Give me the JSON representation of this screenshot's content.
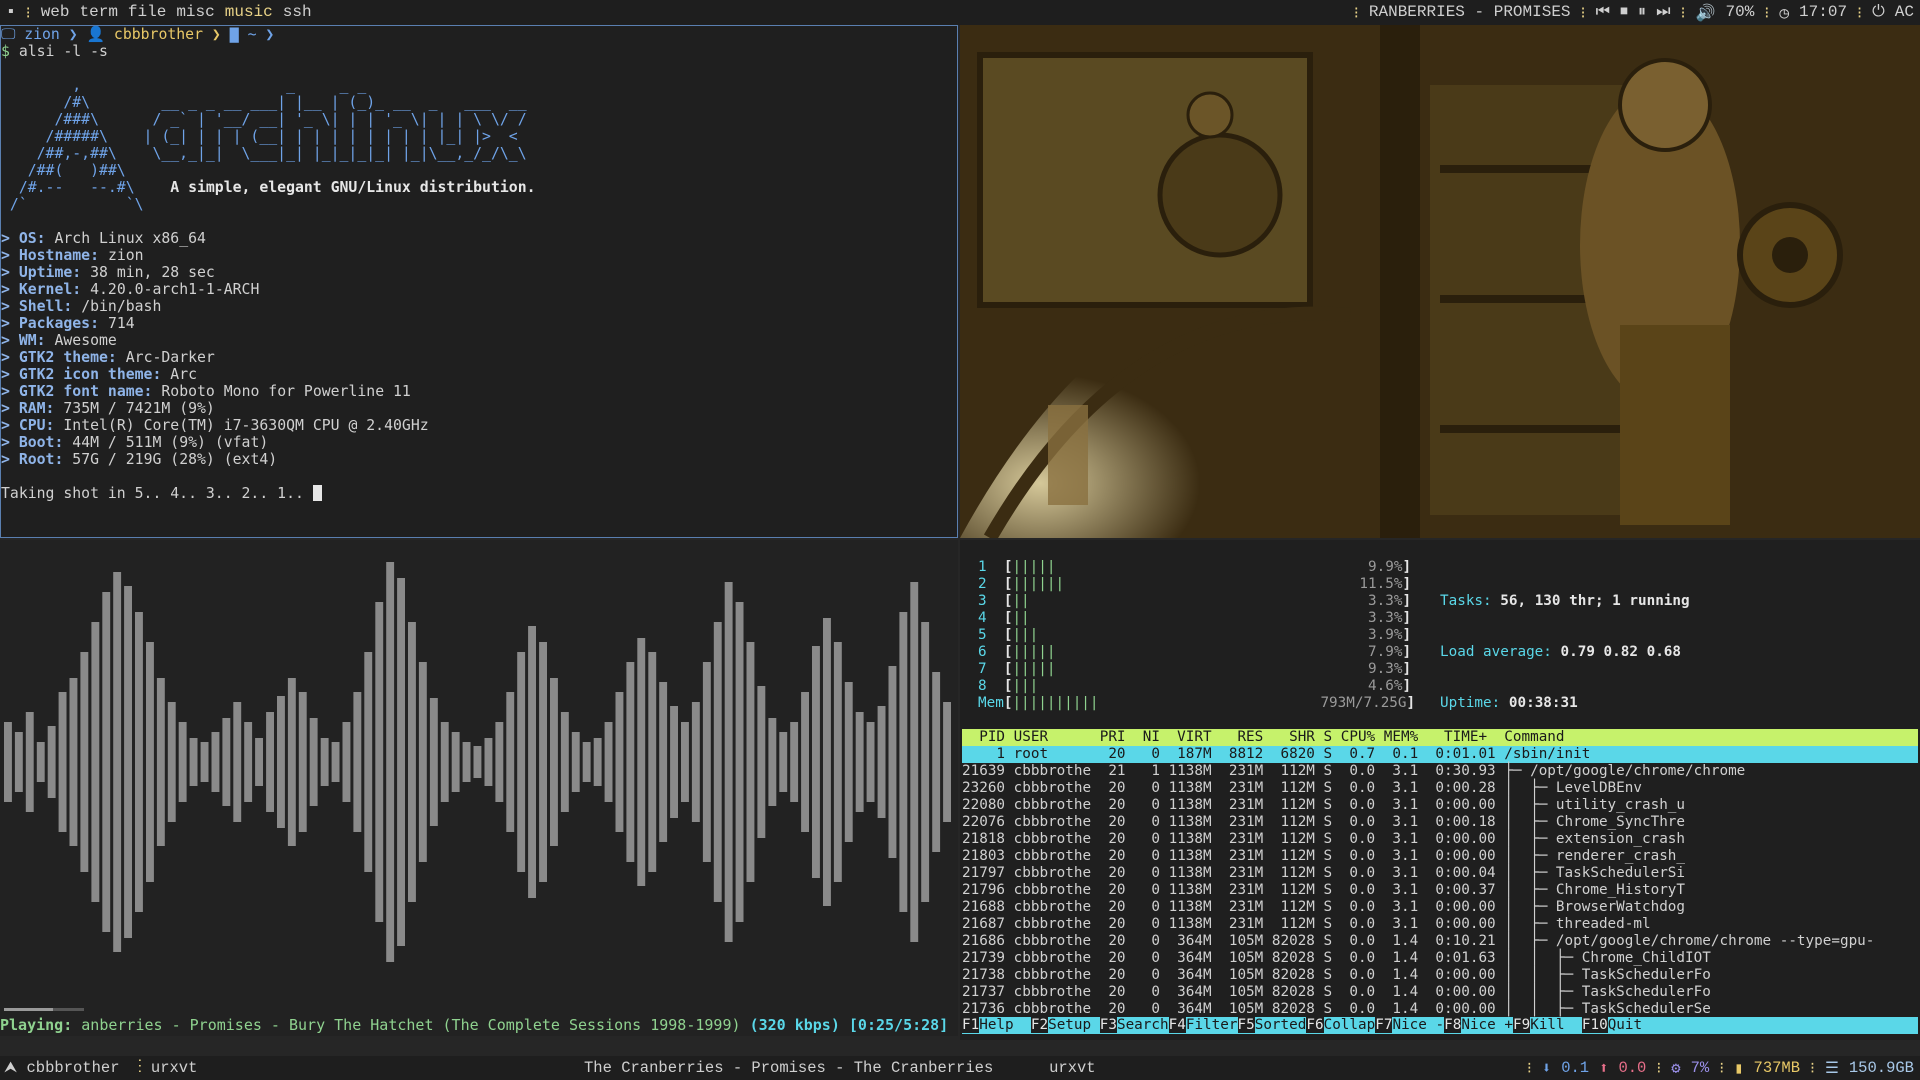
{
  "topbar": {
    "tags": [
      "web",
      "term",
      "file",
      "misc",
      "music",
      "ssh"
    ],
    "active_tag": "music",
    "now_playing": "RANBERRIES - PROMISES",
    "volume": "70%",
    "time": "17:07",
    "power": "AC"
  },
  "terminal": {
    "prompt_host": "zion",
    "prompt_user": "cbbbrother",
    "prompt_dir": "~",
    "command": "alsi -l -s",
    "tagline": "A simple, elegant GNU/Linux distribution.",
    "info": [
      {
        "label": "OS:",
        "value": "Arch Linux x86_64"
      },
      {
        "label": "Hostname:",
        "value": "zion"
      },
      {
        "label": "Uptime:",
        "value": "38 min, 28 sec"
      },
      {
        "label": "Kernel:",
        "value": "4.20.0-arch1-1-ARCH"
      },
      {
        "label": "Shell:",
        "value": "/bin/bash"
      },
      {
        "label": "Packages:",
        "value": "714"
      },
      {
        "label": "WM:",
        "value": "Awesome"
      },
      {
        "label": "GTK2 theme:",
        "value": "Arc-Darker"
      },
      {
        "label": "GTK2 icon theme:",
        "value": "Arc"
      },
      {
        "label": "GTK2 font name:",
        "value": "Roboto Mono for Powerline 11"
      },
      {
        "label": "RAM:",
        "value": "735M / 7421M (9%)"
      },
      {
        "label": "CPU:",
        "value": "Intel(R) Core(TM) i7-3630QM CPU @ 2.40GHz"
      },
      {
        "label": "Boot:",
        "value": "44M / 511M (9%) (vfat)"
      },
      {
        "label": "Root:",
        "value": "57G / 219G (28%) (ext4)"
      }
    ],
    "countdown": "Taking shot in 5.. 4.. 3.. 2.. 1.. "
  },
  "player": {
    "prefix": "Playing:",
    "title": "anberries - Promises - Bury The Hatchet (The Complete Sessions 1998-1999)",
    "bitrate": "(320 kbps)",
    "position": "[0:25/5:28]",
    "progress": 0.076
  },
  "htop": {
    "cpus": [
      {
        "n": "1",
        "bars": "|||||",
        "pct": "9.9%"
      },
      {
        "n": "2",
        "bars": "||||||",
        "pct": "11.5%"
      },
      {
        "n": "3",
        "bars": "||",
        "pct": "3.3%"
      },
      {
        "n": "4",
        "bars": "||",
        "pct": "3.3%"
      },
      {
        "n": "5",
        "bars": "|||",
        "pct": "3.9%"
      },
      {
        "n": "6",
        "bars": "|||||",
        "pct": "7.9%"
      },
      {
        "n": "7",
        "bars": "|||||",
        "pct": "9.3%"
      },
      {
        "n": "8",
        "bars": "|||",
        "pct": "4.6%"
      }
    ],
    "mem": {
      "label": "Mem",
      "bars": "||||||||||",
      "value": "793M/7.25G"
    },
    "tasks_label": "Tasks:",
    "tasks": "56, 130 thr; 1 running",
    "load_label": "Load average:",
    "load": "0.79 0.82 0.68",
    "uptime_label": "Uptime:",
    "uptime": "00:38:31",
    "header": "  PID USER      PRI  NI  VIRT   RES   SHR S CPU% MEM%   TIME+  Command",
    "rows": [
      "    1 root       20   0  187M  8812  6820 S  0.7  0.1  0:01.01 /sbin/init",
      "21639 cbbbrothe  21   1 1138M  231M  112M S  0.0  3.1  0:30.93 ├─ /opt/google/chrome/chrome",
      "23260 cbbbrothe  20   0 1138M  231M  112M S  0.0  3.1  0:00.28 │  ├─ LevelDBEnv",
      "22080 cbbbrothe  20   0 1138M  231M  112M S  0.0  3.1  0:00.00 │  ├─ utility_crash_u",
      "22076 cbbbrothe  20   0 1138M  231M  112M S  0.0  3.1  0:00.18 │  ├─ Chrome_SyncThre",
      "21818 cbbbrothe  20   0 1138M  231M  112M S  0.0  3.1  0:00.00 │  ├─ extension_crash",
      "21803 cbbbrothe  20   0 1138M  231M  112M S  0.0  3.1  0:00.00 │  ├─ renderer_crash_",
      "21797 cbbbrothe  20   0 1138M  231M  112M S  0.0  3.1  0:00.04 │  ├─ TaskSchedulerSi",
      "21796 cbbbrothe  20   0 1138M  231M  112M S  0.0  3.1  0:00.37 │  ├─ Chrome_HistoryT",
      "21688 cbbbrothe  20   0 1138M  231M  112M S  0.0  3.1  0:00.00 │  ├─ BrowserWatchdog",
      "21687 cbbbrothe  20   0 1138M  231M  112M S  0.0  3.1  0:00.00 │  ├─ threaded-ml",
      "21686 cbbbrothe  20   0  364M  105M 82028 S  0.0  1.4  0:10.21 │  ├─ /opt/google/chrome/chrome --type=gpu-",
      "21739 cbbbrothe  20   0  364M  105M 82028 S  0.0  1.4  0:01.63 │  │  ├─ Chrome_ChildIOT",
      "21738 cbbbrothe  20   0  364M  105M 82028 S  0.0  1.4  0:00.00 │  │  ├─ TaskSchedulerFo",
      "21737 cbbbrothe  20   0  364M  105M 82028 S  0.0  1.4  0:00.00 │  │  ├─ TaskSchedulerFo",
      "21736 cbbbrothe  20   0  364M  105M 82028 S  0.0  1.4  0:00.00 │  │  ├─ TaskSchedulerSe"
    ],
    "fkeys": [
      {
        "key": "F1",
        "label": "Help  "
      },
      {
        "key": "F2",
        "label": "Setup "
      },
      {
        "key": "F3",
        "label": "Search"
      },
      {
        "key": "F4",
        "label": "Filter"
      },
      {
        "key": "F5",
        "label": "Sorted"
      },
      {
        "key": "F6",
        "label": "Collap"
      },
      {
        "key": "F7",
        "label": "Nice -"
      },
      {
        "key": "F8",
        "label": "Nice +"
      },
      {
        "key": "F9",
        "label": "Kill  "
      },
      {
        "key": "F10",
        "label": "Quit"
      }
    ]
  },
  "bottombar": {
    "user": "cbbbrother",
    "launcher": "urxvt",
    "task_title": "The Cranberries - Promises - The Cranberries",
    "task_urxvt": "urxvt",
    "net_down": "0.1",
    "net_up": "0.0",
    "cpu": "7%",
    "mem": "737MB",
    "disk": "150.9GB"
  },
  "visualizer": {
    "levels": [
      0.2,
      0.15,
      0.25,
      0.1,
      0.18,
      0.35,
      0.42,
      0.55,
      0.7,
      0.85,
      0.95,
      0.88,
      0.75,
      0.6,
      0.42,
      0.3,
      0.2,
      0.12,
      0.1,
      0.15,
      0.22,
      0.3,
      0.2,
      0.12,
      0.25,
      0.33,
      0.42,
      0.35,
      0.22,
      0.12,
      0.1,
      0.2,
      0.35,
      0.55,
      0.8,
      1.0,
      0.92,
      0.7,
      0.5,
      0.32,
      0.2,
      0.15,
      0.1,
      0.08,
      0.12,
      0.2,
      0.35,
      0.55,
      0.68,
      0.6,
      0.42,
      0.25,
      0.15,
      0.1,
      0.12,
      0.2,
      0.35,
      0.5,
      0.62,
      0.55,
      0.4,
      0.28,
      0.2,
      0.3,
      0.5,
      0.7,
      0.9,
      0.8,
      0.6,
      0.38,
      0.22,
      0.15,
      0.2,
      0.35,
      0.58,
      0.72,
      0.6,
      0.4,
      0.25,
      0.2,
      0.28,
      0.48,
      0.75,
      0.9,
      0.7,
      0.45,
      0.3
    ]
  }
}
